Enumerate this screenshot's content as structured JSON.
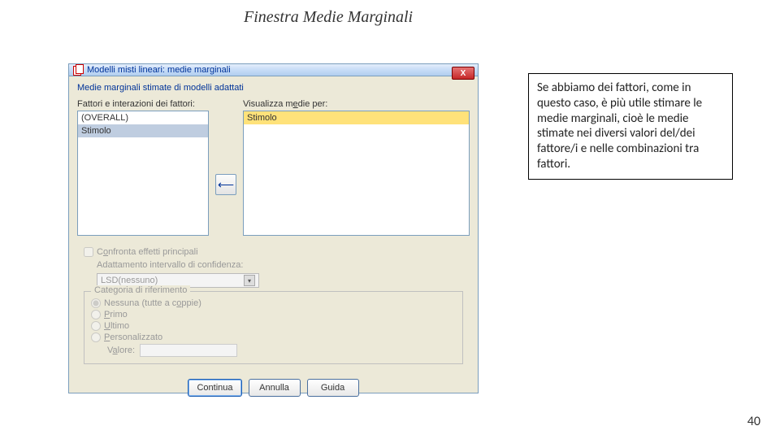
{
  "slide": {
    "title": "Finestra Medie Marginali",
    "page_number": "40"
  },
  "dialog": {
    "title": "Modelli misti lineari: medie marginali",
    "close_label": "X",
    "section_heading": "Medie marginali stimate di modelli adattati",
    "left_list": {
      "label": "Fattori e interazioni dei fattori:",
      "items": [
        "(OVERALL)",
        "Stimolo"
      ]
    },
    "arrow_symbol": "⟵",
    "right_list": {
      "label": "Visualizza medie per:",
      "items": [
        "Stimolo"
      ]
    },
    "compare": {
      "checkbox_label": "Confronta effetti principali",
      "ci_label": "Adattamento intervallo di confidenza:",
      "ci_value": "LSD(nessuno)"
    },
    "ref_category": {
      "group_title": "Categoria di riferimento",
      "options": [
        "Nessuna (tutte a coppie)",
        "Primo",
        "Ultimo",
        "Personalizzato"
      ],
      "value_label": "Valore:"
    },
    "buttons": {
      "continue": "Continua",
      "cancel": "Annulla",
      "help": "Guida"
    }
  },
  "annotation": {
    "text": "Se abbiamo dei fattori, come in questo caso, è più utile stimare le medie marginali, cioè le medie stimate nei diversi valori del/dei fattore/i e nelle combinazioni tra fattori."
  }
}
